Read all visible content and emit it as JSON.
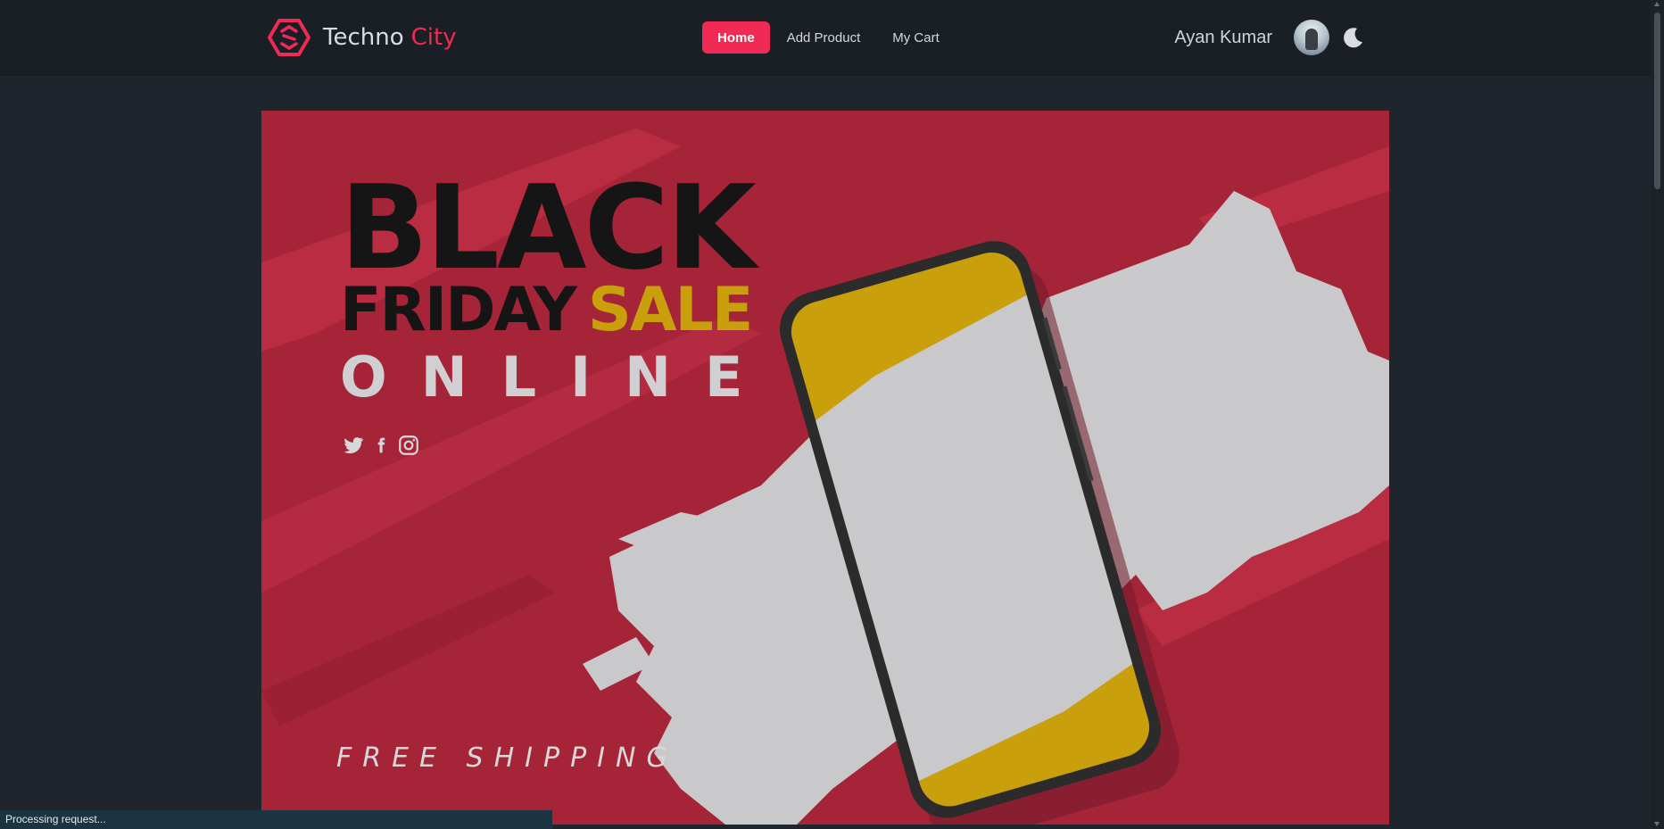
{
  "brand": {
    "name": "Techno",
    "accent": "City",
    "logo_icon": "hexagon-logo-icon"
  },
  "nav": {
    "items": [
      {
        "label": "Home",
        "active": true
      },
      {
        "label": "Add Product",
        "active": false
      },
      {
        "label": "My Cart",
        "active": false
      }
    ]
  },
  "user": {
    "name": "Ayan Kumar",
    "avatar_icon": "user-avatar",
    "theme_icon": "moon-icon"
  },
  "banner": {
    "line1": "BLACK",
    "line2a": "FRIDAY",
    "line2b": "SALE",
    "line3": "ONLINE",
    "footer": "FREE SHIPPING",
    "social_icons": [
      "twitter-icon",
      "facebook-icon",
      "instagram-icon"
    ]
  },
  "status_bar": {
    "text": "Processing request..."
  },
  "colors": {
    "accent": "#ef2a55",
    "banner_red": "#a62438",
    "gold": "#c9a00b",
    "nav_bg": "#1a1f26",
    "page_bg": "#1f252c"
  }
}
